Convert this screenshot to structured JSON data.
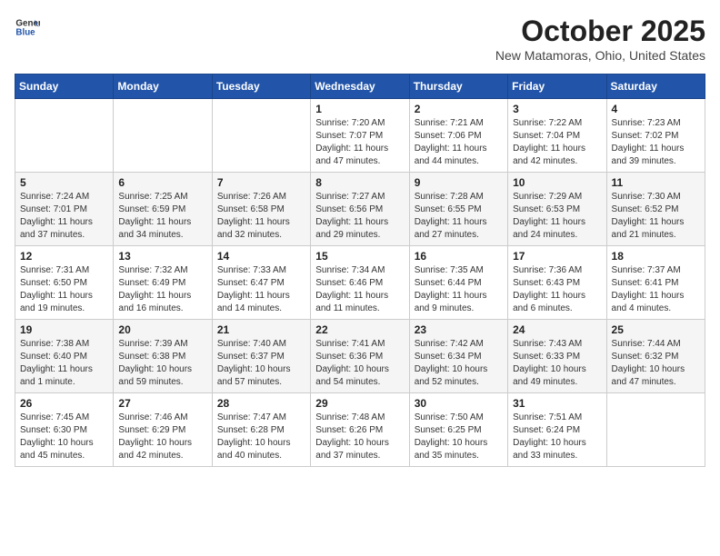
{
  "header": {
    "logo_line1": "General",
    "logo_line2": "Blue",
    "month": "October 2025",
    "location": "New Matamoras, Ohio, United States"
  },
  "weekdays": [
    "Sunday",
    "Monday",
    "Tuesday",
    "Wednesday",
    "Thursday",
    "Friday",
    "Saturday"
  ],
  "weeks": [
    [
      {
        "day": "",
        "info": ""
      },
      {
        "day": "",
        "info": ""
      },
      {
        "day": "",
        "info": ""
      },
      {
        "day": "1",
        "info": "Sunrise: 7:20 AM\nSunset: 7:07 PM\nDaylight: 11 hours and 47 minutes."
      },
      {
        "day": "2",
        "info": "Sunrise: 7:21 AM\nSunset: 7:06 PM\nDaylight: 11 hours and 44 minutes."
      },
      {
        "day": "3",
        "info": "Sunrise: 7:22 AM\nSunset: 7:04 PM\nDaylight: 11 hours and 42 minutes."
      },
      {
        "day": "4",
        "info": "Sunrise: 7:23 AM\nSunset: 7:02 PM\nDaylight: 11 hours and 39 minutes."
      }
    ],
    [
      {
        "day": "5",
        "info": "Sunrise: 7:24 AM\nSunset: 7:01 PM\nDaylight: 11 hours and 37 minutes."
      },
      {
        "day": "6",
        "info": "Sunrise: 7:25 AM\nSunset: 6:59 PM\nDaylight: 11 hours and 34 minutes."
      },
      {
        "day": "7",
        "info": "Sunrise: 7:26 AM\nSunset: 6:58 PM\nDaylight: 11 hours and 32 minutes."
      },
      {
        "day": "8",
        "info": "Sunrise: 7:27 AM\nSunset: 6:56 PM\nDaylight: 11 hours and 29 minutes."
      },
      {
        "day": "9",
        "info": "Sunrise: 7:28 AM\nSunset: 6:55 PM\nDaylight: 11 hours and 27 minutes."
      },
      {
        "day": "10",
        "info": "Sunrise: 7:29 AM\nSunset: 6:53 PM\nDaylight: 11 hours and 24 minutes."
      },
      {
        "day": "11",
        "info": "Sunrise: 7:30 AM\nSunset: 6:52 PM\nDaylight: 11 hours and 21 minutes."
      }
    ],
    [
      {
        "day": "12",
        "info": "Sunrise: 7:31 AM\nSunset: 6:50 PM\nDaylight: 11 hours and 19 minutes."
      },
      {
        "day": "13",
        "info": "Sunrise: 7:32 AM\nSunset: 6:49 PM\nDaylight: 11 hours and 16 minutes."
      },
      {
        "day": "14",
        "info": "Sunrise: 7:33 AM\nSunset: 6:47 PM\nDaylight: 11 hours and 14 minutes."
      },
      {
        "day": "15",
        "info": "Sunrise: 7:34 AM\nSunset: 6:46 PM\nDaylight: 11 hours and 11 minutes."
      },
      {
        "day": "16",
        "info": "Sunrise: 7:35 AM\nSunset: 6:44 PM\nDaylight: 11 hours and 9 minutes."
      },
      {
        "day": "17",
        "info": "Sunrise: 7:36 AM\nSunset: 6:43 PM\nDaylight: 11 hours and 6 minutes."
      },
      {
        "day": "18",
        "info": "Sunrise: 7:37 AM\nSunset: 6:41 PM\nDaylight: 11 hours and 4 minutes."
      }
    ],
    [
      {
        "day": "19",
        "info": "Sunrise: 7:38 AM\nSunset: 6:40 PM\nDaylight: 11 hours and 1 minute."
      },
      {
        "day": "20",
        "info": "Sunrise: 7:39 AM\nSunset: 6:38 PM\nDaylight: 10 hours and 59 minutes."
      },
      {
        "day": "21",
        "info": "Sunrise: 7:40 AM\nSunset: 6:37 PM\nDaylight: 10 hours and 57 minutes."
      },
      {
        "day": "22",
        "info": "Sunrise: 7:41 AM\nSunset: 6:36 PM\nDaylight: 10 hours and 54 minutes."
      },
      {
        "day": "23",
        "info": "Sunrise: 7:42 AM\nSunset: 6:34 PM\nDaylight: 10 hours and 52 minutes."
      },
      {
        "day": "24",
        "info": "Sunrise: 7:43 AM\nSunset: 6:33 PM\nDaylight: 10 hours and 49 minutes."
      },
      {
        "day": "25",
        "info": "Sunrise: 7:44 AM\nSunset: 6:32 PM\nDaylight: 10 hours and 47 minutes."
      }
    ],
    [
      {
        "day": "26",
        "info": "Sunrise: 7:45 AM\nSunset: 6:30 PM\nDaylight: 10 hours and 45 minutes."
      },
      {
        "day": "27",
        "info": "Sunrise: 7:46 AM\nSunset: 6:29 PM\nDaylight: 10 hours and 42 minutes."
      },
      {
        "day": "28",
        "info": "Sunrise: 7:47 AM\nSunset: 6:28 PM\nDaylight: 10 hours and 40 minutes."
      },
      {
        "day": "29",
        "info": "Sunrise: 7:48 AM\nSunset: 6:26 PM\nDaylight: 10 hours and 37 minutes."
      },
      {
        "day": "30",
        "info": "Sunrise: 7:50 AM\nSunset: 6:25 PM\nDaylight: 10 hours and 35 minutes."
      },
      {
        "day": "31",
        "info": "Sunrise: 7:51 AM\nSunset: 6:24 PM\nDaylight: 10 hours and 33 minutes."
      },
      {
        "day": "",
        "info": ""
      }
    ]
  ]
}
